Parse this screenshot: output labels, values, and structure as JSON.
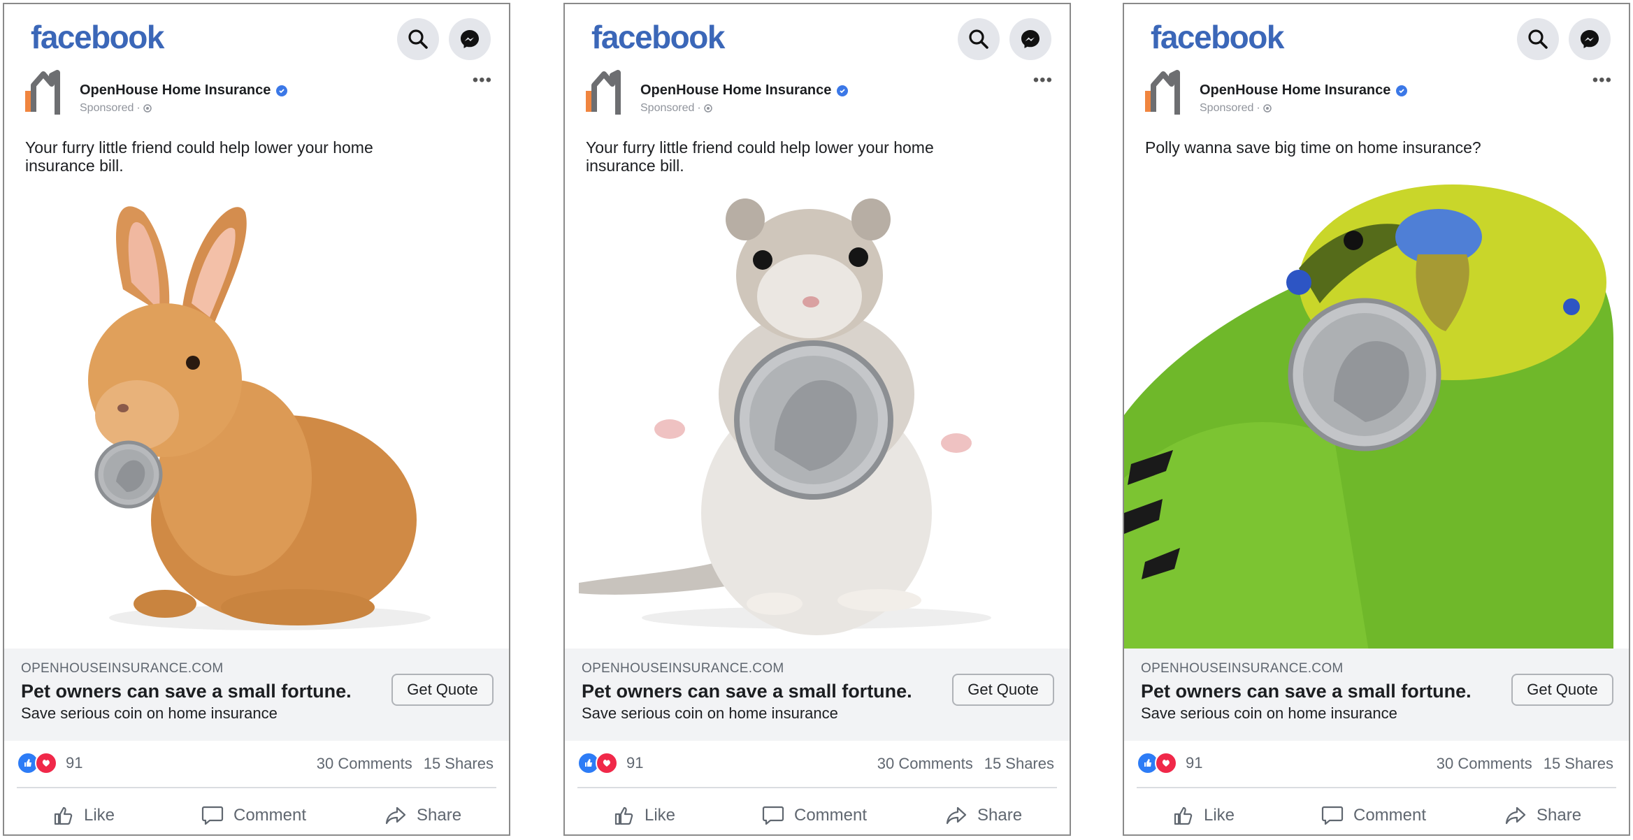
{
  "brand": {
    "logo_text": "facebook",
    "color": "#3b67b8"
  },
  "cards": [
    {
      "page_name": "OpenHouse Home Insurance",
      "sponsored": "Sponsored",
      "post_text": "Your furry little friend could help lower your home insurance bill.",
      "image_subject": "rabbit-with-coin",
      "link": {
        "domain": "OPENHOUSEINSURANCE.COM",
        "headline": "Pet owners can save a small fortune.",
        "description": "Save serious coin on home insurance",
        "cta": "Get Quote"
      },
      "reaction_count": "91",
      "comments": "30 Comments",
      "shares": "15 Shares",
      "actions": {
        "like": "Like",
        "comment": "Comment",
        "share": "Share"
      }
    },
    {
      "page_name": "OpenHouse Home Insurance",
      "sponsored": "Sponsored",
      "post_text": "Your furry little friend could help lower your home insurance bill.",
      "image_subject": "hamster-with-coin",
      "link": {
        "domain": "OPENHOUSEINSURANCE.COM",
        "headline": "Pet owners can save a small fortune.",
        "description": "Save serious coin on home insurance",
        "cta": "Get Quote"
      },
      "reaction_count": "91",
      "comments": "30 Comments",
      "shares": "15 Shares",
      "actions": {
        "like": "Like",
        "comment": "Comment",
        "share": "Share"
      }
    },
    {
      "page_name": "OpenHouse Home Insurance",
      "sponsored": "Sponsored",
      "post_text": "Polly wanna save big time on home insurance?",
      "image_subject": "parakeet-with-coin",
      "link": {
        "domain": "OPENHOUSEINSURANCE.COM",
        "headline": "Pet owners can save a small fortune.",
        "description": "Save serious coin on home insurance",
        "cta": "Get Quote"
      },
      "reaction_count": "91",
      "comments": "30 Comments",
      "shares": "15 Shares",
      "actions": {
        "like": "Like",
        "comment": "Comment",
        "share": "Share"
      }
    }
  ],
  "colors": {
    "accent": "#3b67b8",
    "like_blue": "#2d7cf6",
    "love_red": "#f02849",
    "house_orange": "#f0853f",
    "house_gray": "#6d6e71"
  }
}
